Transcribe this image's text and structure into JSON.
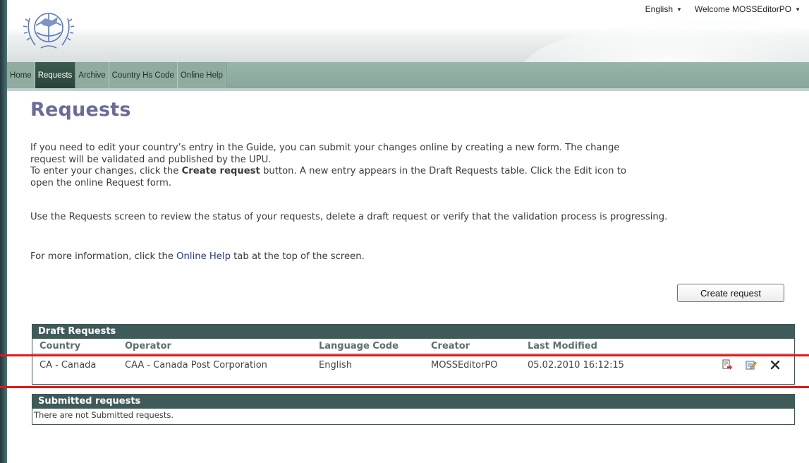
{
  "header": {
    "language": "English",
    "welcome": "Welcome MOSSEditorPO"
  },
  "nav": {
    "tabs": [
      {
        "label": "Home"
      },
      {
        "label": "Requests"
      },
      {
        "label": "Archive"
      },
      {
        "label": "Country Hs Code"
      },
      {
        "label": "Online Help"
      }
    ]
  },
  "page": {
    "title": "Requests",
    "para1_line1": "If you need to edit your country’s entry in the Guide, you can submit your changes online by creating a new form. The change",
    "para1_line2": "request will be validated and published by the UPU.",
    "para2_pre": "To enter your changes, click the ",
    "para2_bold": "Create request",
    "para2_post": " button. A new entry appears in the Draft Requests table. Click the Edit icon to",
    "para2_line2": "open the online Request form.",
    "para3": "Use the Requests screen to review the status of your requests, delete a draft request or verify that the validation process is progressing.",
    "para4_pre": "For more information, click the ",
    "para4_link": "Online Help",
    "para4_post": " tab at the top of the screen.",
    "create_button": "Create request"
  },
  "draft": {
    "title": "Draft Requests",
    "columns": [
      "Country",
      "Operator",
      "Language Code",
      "Creator",
      "Last Modified"
    ],
    "rows": [
      {
        "country": "CA - Canada",
        "operator": "CAA - Canada Post Corporation",
        "language": "English",
        "creator": "MOSSEditorPO",
        "modified": "05.02.2010 16:12:15"
      }
    ]
  },
  "submitted": {
    "title": "Submitted requests",
    "empty": "There are not Submitted requests."
  },
  "colors": {
    "panel_header": "#3f5b59",
    "title": "#6b6b9a",
    "nav_active": "#294339",
    "annotation": "#e01818"
  },
  "icons": [
    "upu-logo",
    "submit-icon",
    "edit-icon",
    "delete-icon"
  ]
}
